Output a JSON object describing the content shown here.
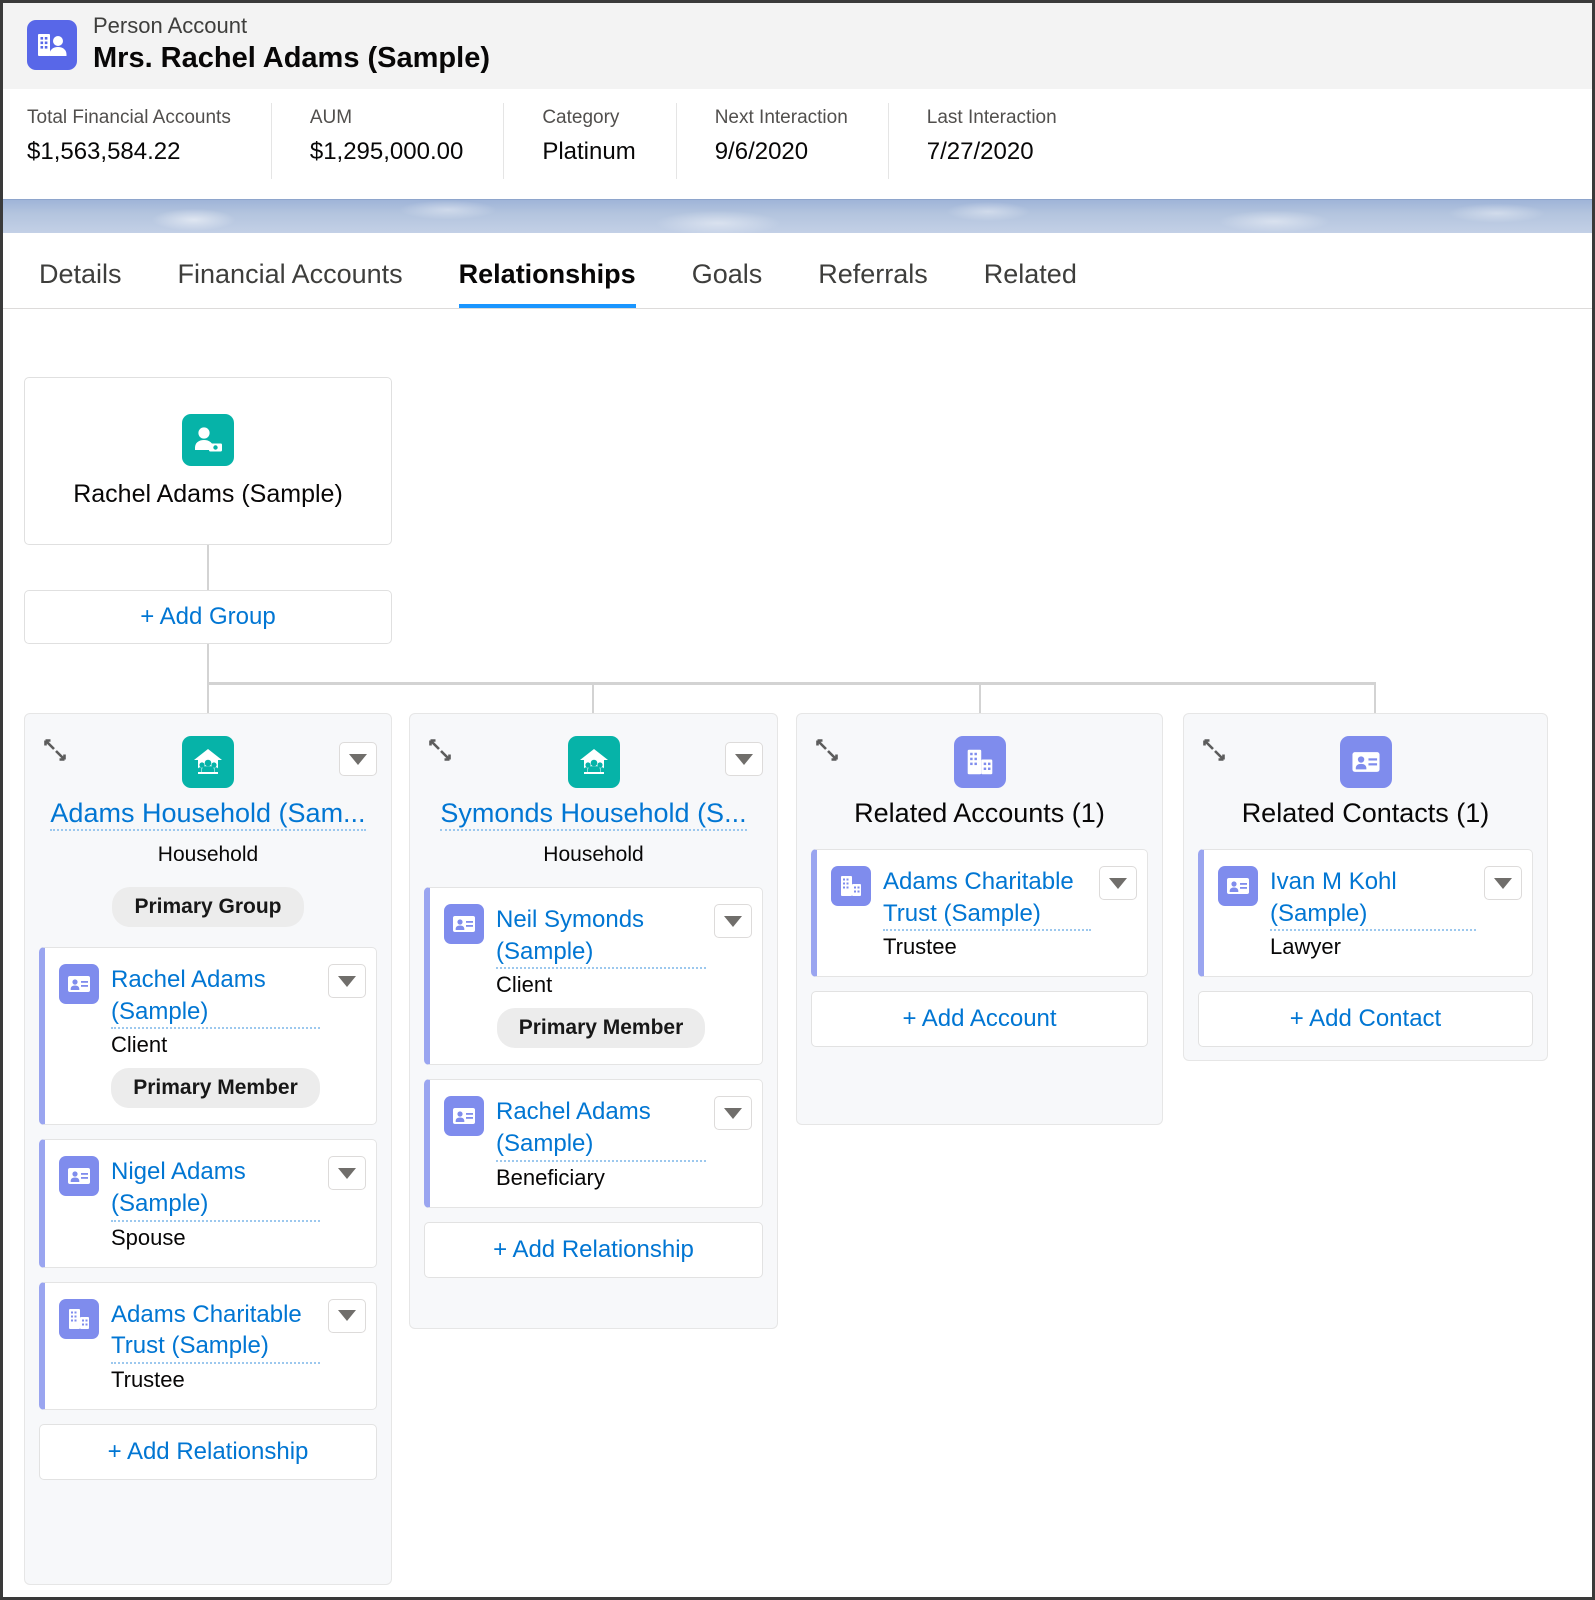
{
  "record": {
    "object_label": "Person Account",
    "name": "Mrs. Rachel Adams (Sample)",
    "icon": "person-account-icon"
  },
  "highlights": [
    {
      "label": "Total Financial Accounts",
      "value": "$1,563,584.22"
    },
    {
      "label": "AUM",
      "value": "$1,295,000.00"
    },
    {
      "label": "Category",
      "value": "Platinum"
    },
    {
      "label": "Next Interaction",
      "value": "9/6/2020"
    },
    {
      "label": "Last Interaction",
      "value": "7/27/2020"
    }
  ],
  "tabs": [
    {
      "label": "Details",
      "active": false
    },
    {
      "label": "Financial Accounts",
      "active": false
    },
    {
      "label": "Relationships",
      "active": true
    },
    {
      "label": "Goals",
      "active": false
    },
    {
      "label": "Referrals",
      "active": false
    },
    {
      "label": "Related",
      "active": false
    }
  ],
  "tree": {
    "root": {
      "label": "Rachel Adams (Sample)",
      "icon": "person-money-icon"
    },
    "add_group_label": "+ Add Group",
    "groups": [
      {
        "title": "Adams Household (Sam...",
        "title_is_link": true,
        "subtitle": "Household",
        "icon": "household-icon",
        "icon_color": "teal",
        "badge": "Primary Group",
        "collapse_icon": "collapse-icon",
        "caret_icon": "chevron-down-icon",
        "members": [
          {
            "name": "Rachel Adams (Sample)",
            "role": "Client",
            "badge": "Primary Member",
            "icon": "contact-card-icon"
          },
          {
            "name": "Nigel Adams (Sample)",
            "role": "Spouse",
            "badge": "",
            "icon": "contact-card-icon"
          },
          {
            "name": "Adams Charitable Trust (Sample)",
            "role": "Trustee",
            "badge": "",
            "icon": "business-account-icon"
          }
        ],
        "add_label": "+ Add Relationship"
      },
      {
        "title": "Symonds Household (S...",
        "title_is_link": true,
        "subtitle": "Household",
        "icon": "household-icon",
        "icon_color": "teal",
        "badge": "",
        "collapse_icon": "collapse-icon",
        "caret_icon": "chevron-down-icon",
        "members": [
          {
            "name": "Neil Symonds (Sample)",
            "role": "Client",
            "badge": "Primary Member",
            "icon": "contact-card-icon"
          },
          {
            "name": "Rachel Adams (Sample)",
            "role": "Beneficiary",
            "badge": "",
            "icon": "contact-card-icon"
          }
        ],
        "add_label": "+ Add Relationship"
      },
      {
        "title": "Related Accounts (1)",
        "title_is_link": false,
        "subtitle": "",
        "icon": "business-account-icon",
        "icon_color": "indigo",
        "badge": "",
        "collapse_icon": "collapse-icon",
        "caret_icon": "",
        "members": [
          {
            "name": "Adams Charitable Trust (Sample)",
            "role": "Trustee",
            "badge": "",
            "icon": "business-account-icon"
          }
        ],
        "add_label": "+ Add Account"
      },
      {
        "title": "Related Contacts (1)",
        "title_is_link": false,
        "subtitle": "",
        "icon": "contact-card-icon",
        "icon_color": "indigo",
        "badge": "",
        "collapse_icon": "collapse-icon",
        "caret_icon": "",
        "members": [
          {
            "name": "Ivan M Kohl (Sample)",
            "role": "Lawyer",
            "badge": "",
            "icon": "contact-card-icon"
          }
        ],
        "add_label": "+ Add Contact"
      }
    ]
  },
  "colors": {
    "link": "#0176d3",
    "accent_tab": "#1b96ff",
    "teal": "#06b3a8",
    "indigo": "#7f8ced",
    "member_bar": "#9aa5f0",
    "band": "#b3c4de"
  }
}
